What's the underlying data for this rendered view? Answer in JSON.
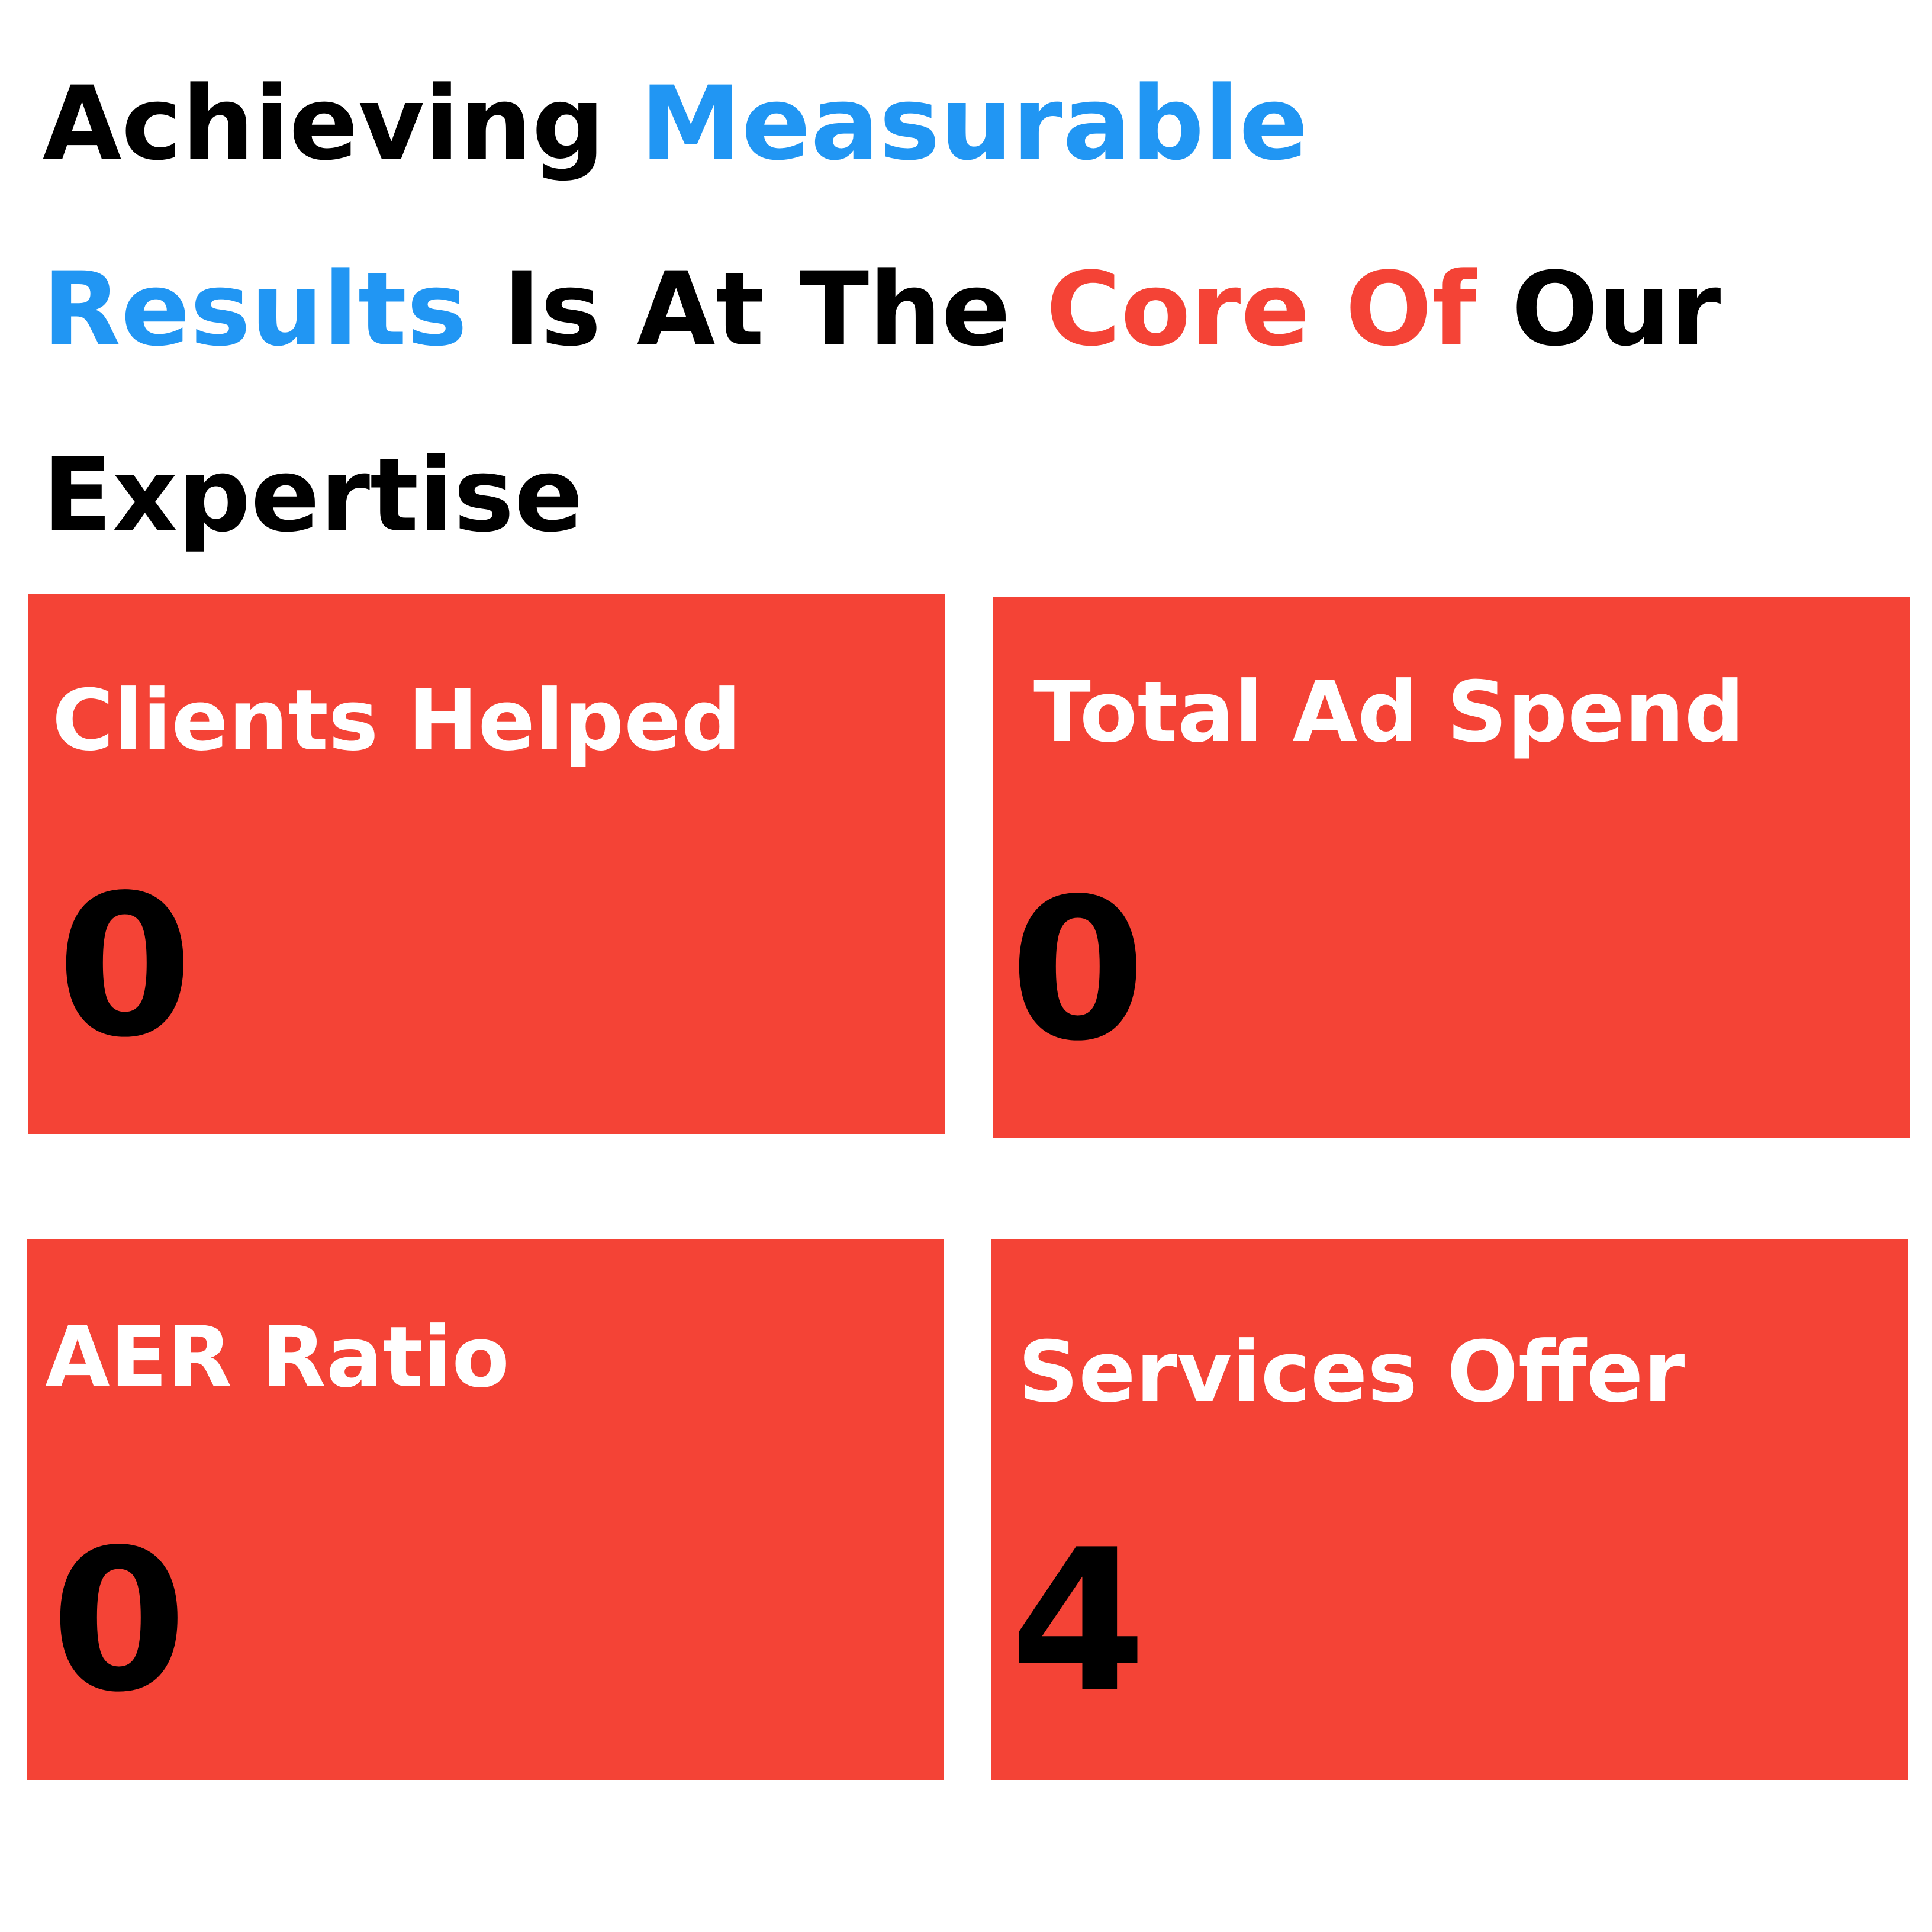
{
  "heading": {
    "line1_a": "Achieving ",
    "line1_b": "Measurable",
    "line2_a": "Results",
    "line2_b": " Is At The ",
    "line2_c": "Core Of",
    "line2_d": " Our",
    "line3": "Expertise"
  },
  "colors": {
    "accent_blue": "#2196f3",
    "accent_red": "#f44336",
    "text_dark": "#000000",
    "text_light": "#ffffff"
  },
  "stats": [
    {
      "label": "Clients Helped",
      "value": "0"
    },
    {
      "label": "Total Ad Spend",
      "value": "0"
    },
    {
      "label": "AER Ratio",
      "value": "0"
    },
    {
      "label": "Services Offer",
      "value": "4"
    }
  ]
}
